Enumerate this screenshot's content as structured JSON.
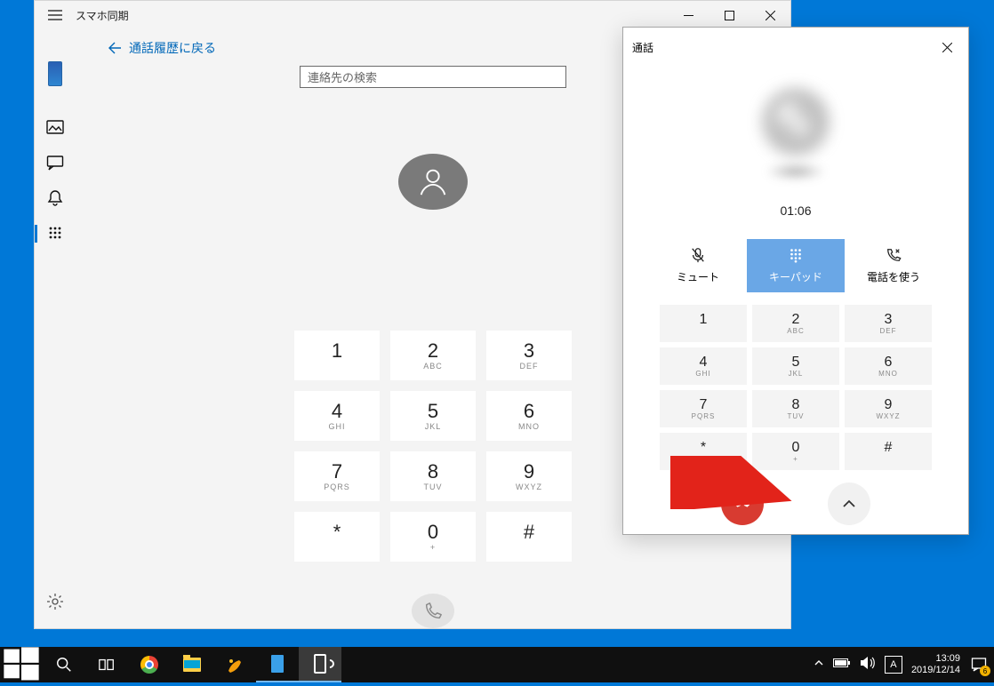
{
  "window": {
    "title": "スマホ同期",
    "back_label": "通話履歴に戻る",
    "search_placeholder": "連絡先の検索"
  },
  "keypad": {
    "keys": [
      {
        "digit": "1",
        "letters": ""
      },
      {
        "digit": "2",
        "letters": "ABC"
      },
      {
        "digit": "3",
        "letters": "DEF"
      },
      {
        "digit": "4",
        "letters": "GHI"
      },
      {
        "digit": "5",
        "letters": "JKL"
      },
      {
        "digit": "6",
        "letters": "MNO"
      },
      {
        "digit": "7",
        "letters": "PQRS"
      },
      {
        "digit": "8",
        "letters": "TUV"
      },
      {
        "digit": "9",
        "letters": "WXYZ"
      },
      {
        "digit": "*",
        "letters": ""
      },
      {
        "digit": "0",
        "letters": "+"
      },
      {
        "digit": "#",
        "letters": ""
      }
    ]
  },
  "callPanel": {
    "title": "通話",
    "timer": "01:06",
    "mute_label": "ミュート",
    "keypad_label": "キーパッド",
    "usephone_label": "電話を使う",
    "keys": [
      {
        "digit": "1",
        "letters": ""
      },
      {
        "digit": "2",
        "letters": "ABC"
      },
      {
        "digit": "3",
        "letters": "DEF"
      },
      {
        "digit": "4",
        "letters": "GHI"
      },
      {
        "digit": "5",
        "letters": "JKL"
      },
      {
        "digit": "6",
        "letters": "MNO"
      },
      {
        "digit": "7",
        "letters": "PQRS"
      },
      {
        "digit": "8",
        "letters": "TUV"
      },
      {
        "digit": "9",
        "letters": "WXYZ"
      },
      {
        "digit": "*",
        "letters": ""
      },
      {
        "digit": "0",
        "letters": "+"
      },
      {
        "digit": "#",
        "letters": ""
      }
    ]
  },
  "taskbar": {
    "time": "13:09",
    "date": "2019/12/14",
    "ime": "A",
    "notification_count": "6"
  }
}
